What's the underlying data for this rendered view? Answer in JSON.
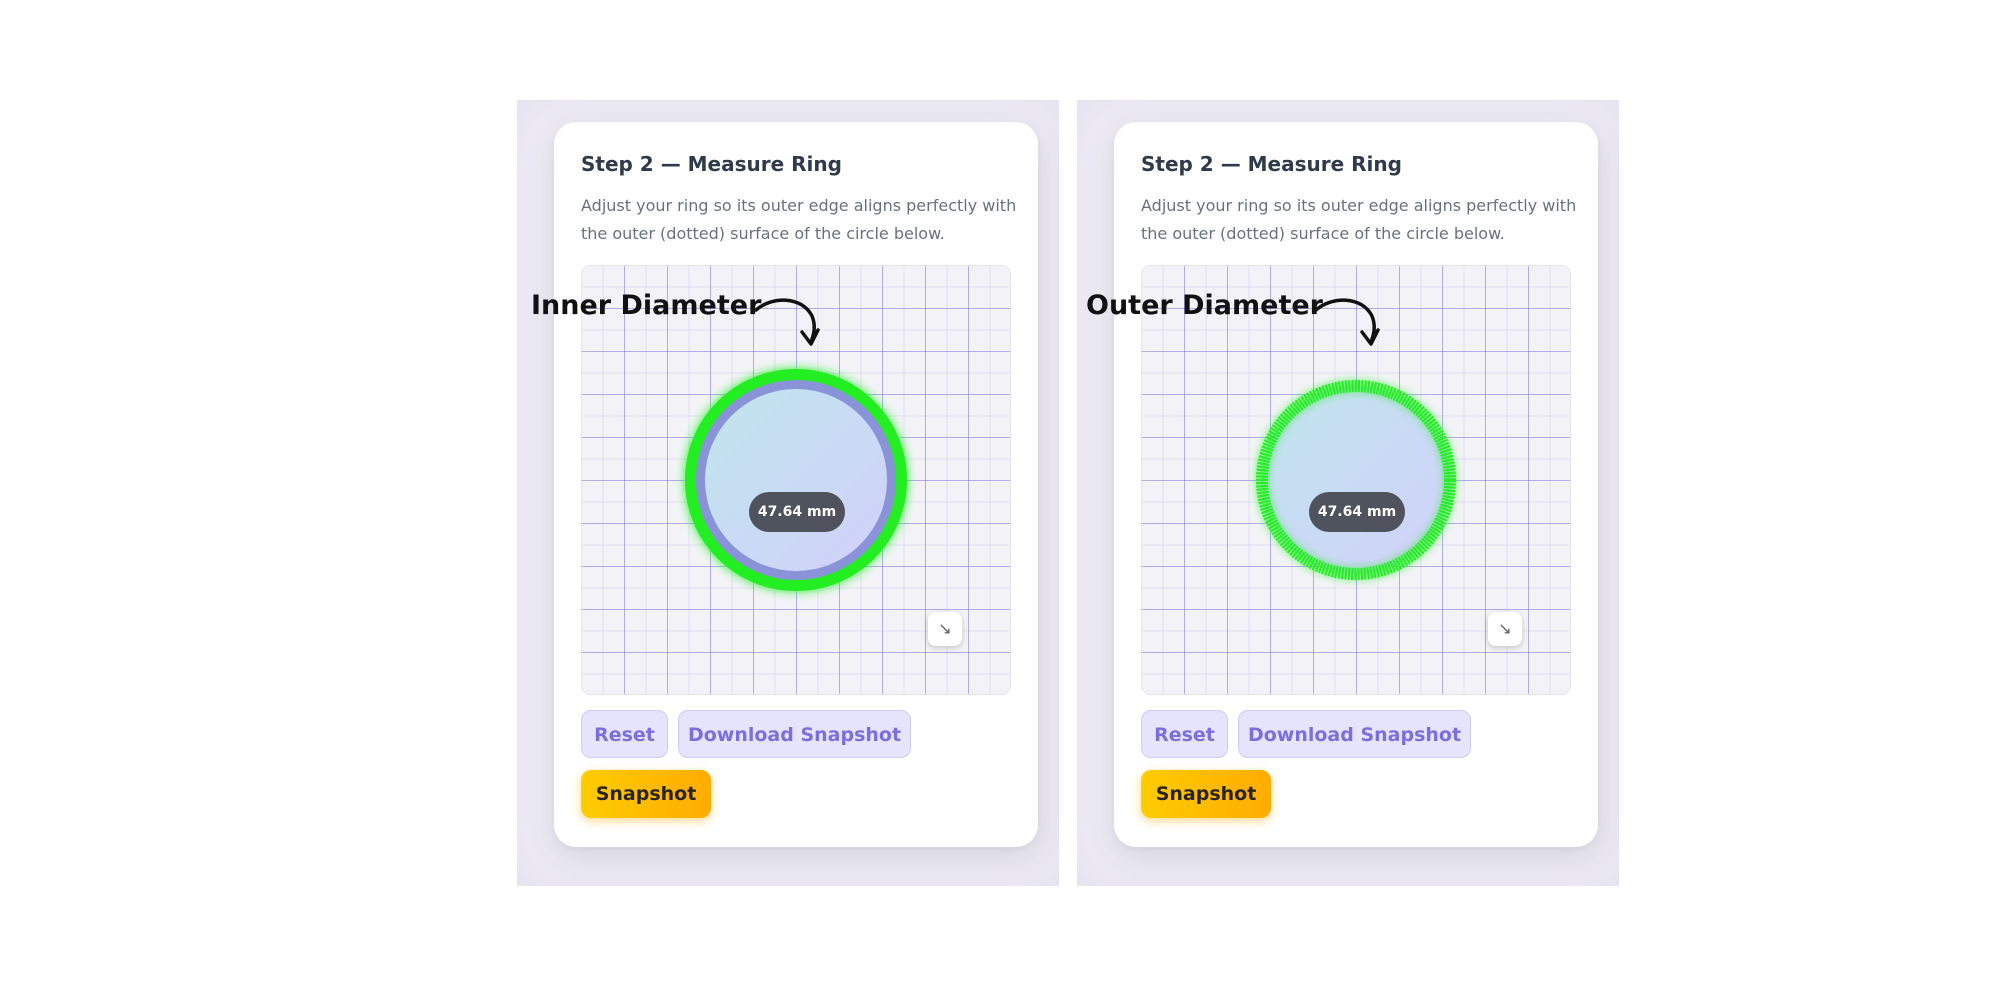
{
  "panels": [
    {
      "title": "Step 2 — Measure Ring",
      "description": "Adjust your ring so its outer edge aligns perfectly with the outer (dotted) surface of the circle below.",
      "measurement": "47.64 mm",
      "annotation": "Inner Diameter",
      "buttons": {
        "reset": "Reset",
        "download": "Download Snapshot",
        "snapshot": "Snapshot"
      }
    },
    {
      "title": "Step 2 — Measure Ring",
      "description": "Adjust your ring so its outer edge aligns perfectly with the outer (dotted) surface of the circle below.",
      "measurement": "47.64 mm",
      "annotation": "Outer Diameter",
      "buttons": {
        "reset": "Reset",
        "download": "Download Snapshot",
        "snapshot": "Snapshot"
      }
    }
  ],
  "icons": {
    "resize": "resize-arrow-icon",
    "annotation_arrow": "curved-arrow-icon"
  },
  "colors": {
    "highlight_ring": "#22ee22",
    "accent_purple": "#7a6fdc",
    "snapshot_yellow": "#ffc107",
    "title": "#2f3b4c"
  }
}
